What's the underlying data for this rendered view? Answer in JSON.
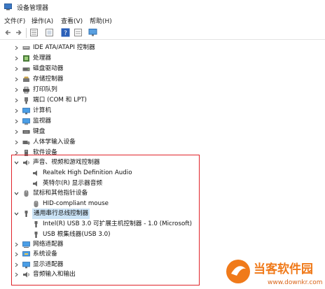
{
  "window": {
    "title": "设备管理器"
  },
  "menu": [
    "文件(F)",
    "操作(A)",
    "查看(V)",
    "帮助(H)"
  ],
  "toolbar": {
    "buttons": [
      "back-icon",
      "forward-icon",
      "properties-icon",
      "show-hidden-icon",
      "help-icon",
      "view-icon",
      "monitor-icon"
    ]
  },
  "tree": {
    "collapsed": [
      {
        "label": "IDE ATA/ATAPI 控制器",
        "icon": "ide-icon"
      },
      {
        "label": "处理器",
        "icon": "processor-icon"
      },
      {
        "label": "磁盘驱动器",
        "icon": "disk-icon"
      },
      {
        "label": "存储控制器",
        "icon": "storage-icon"
      },
      {
        "label": "打印队列",
        "icon": "printer-icon"
      },
      {
        "label": "端口 (COM 和 LPT)",
        "icon": "port-icon"
      },
      {
        "label": "计算机",
        "icon": "computer-icon"
      },
      {
        "label": "监视器",
        "icon": "monitor-icon"
      },
      {
        "label": "键盘",
        "icon": "keyboard-icon"
      },
      {
        "label": "人体学输入设备",
        "icon": "hid-icon"
      },
      {
        "label": "软件设备",
        "icon": "software-icon"
      }
    ],
    "audio": {
      "label": "声音、视频和游戏控制器",
      "children": [
        "Realtek High Definition Audio",
        "英特尔(R) 显示器音频"
      ]
    },
    "mouse": {
      "label": "鼠标和其他指针设备",
      "children": [
        "HID-compliant mouse"
      ]
    },
    "usb": {
      "label": "通用串行总线控制器",
      "children": [
        "Intel(R) USB 3.0 可扩展主机控制器 - 1.0 (Microsoft)",
        "USB 根集线器(USB 3.0)"
      ]
    },
    "collapsed2": [
      {
        "label": "网络适配器",
        "icon": "network-icon"
      },
      {
        "label": "系统设备",
        "icon": "system-icon"
      },
      {
        "label": "显示适配器",
        "icon": "display-adapter-icon"
      },
      {
        "label": "音频输入和输出",
        "icon": "audio-io-icon"
      }
    ]
  },
  "watermark": {
    "brand": "当客软件园",
    "url": "www.downkr.com"
  },
  "colors": {
    "highlight": "#cce4f7",
    "redbox": "#e0242a",
    "watermark_orange": "#f07a1a"
  }
}
